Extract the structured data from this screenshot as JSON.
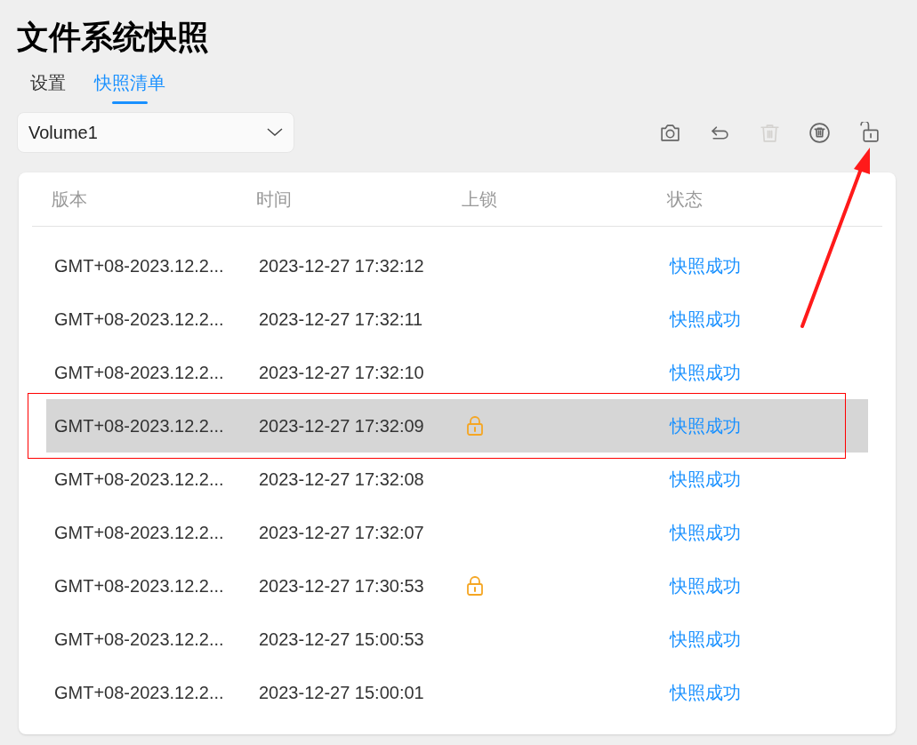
{
  "page": {
    "title": "文件系统快照"
  },
  "tabs": [
    {
      "label": "设置",
      "selected": false
    },
    {
      "label": "快照清单",
      "selected": true
    }
  ],
  "volume_select": {
    "value": "Volume1"
  },
  "toolbar": [
    {
      "kind": "camera",
      "disabled": false
    },
    {
      "kind": "undo",
      "disabled": false
    },
    {
      "kind": "trash",
      "disabled": true
    },
    {
      "kind": "trash-circle",
      "disabled": false
    },
    {
      "kind": "unlock",
      "disabled": false
    }
  ],
  "table": {
    "columns": [
      "版本",
      "时间",
      "上锁",
      "状态"
    ],
    "rows": [
      {
        "version": "GMT+08-2023.12.2...",
        "time": "2023-12-27 17:32:12",
        "locked": false,
        "status": "快照成功",
        "selected": false
      },
      {
        "version": "GMT+08-2023.12.2...",
        "time": "2023-12-27 17:32:11",
        "locked": false,
        "status": "快照成功",
        "selected": false
      },
      {
        "version": "GMT+08-2023.12.2...",
        "time": "2023-12-27 17:32:10",
        "locked": false,
        "status": "快照成功",
        "selected": false
      },
      {
        "version": "GMT+08-2023.12.2...",
        "time": "2023-12-27 17:32:09",
        "locked": true,
        "status": "快照成功",
        "selected": true
      },
      {
        "version": "GMT+08-2023.12.2...",
        "time": "2023-12-27 17:32:08",
        "locked": false,
        "status": "快照成功",
        "selected": false
      },
      {
        "version": "GMT+08-2023.12.2...",
        "time": "2023-12-27 17:32:07",
        "locked": false,
        "status": "快照成功",
        "selected": false
      },
      {
        "version": "GMT+08-2023.12.2...",
        "time": "2023-12-27 17:30:53",
        "locked": true,
        "status": "快照成功",
        "selected": false
      },
      {
        "version": "GMT+08-2023.12.2...",
        "time": "2023-12-27 15:00:53",
        "locked": false,
        "status": "快照成功",
        "selected": false
      },
      {
        "version": "GMT+08-2023.12.2...",
        "time": "2023-12-27 15:00:01",
        "locked": false,
        "status": "快照成功",
        "selected": false
      }
    ]
  }
}
